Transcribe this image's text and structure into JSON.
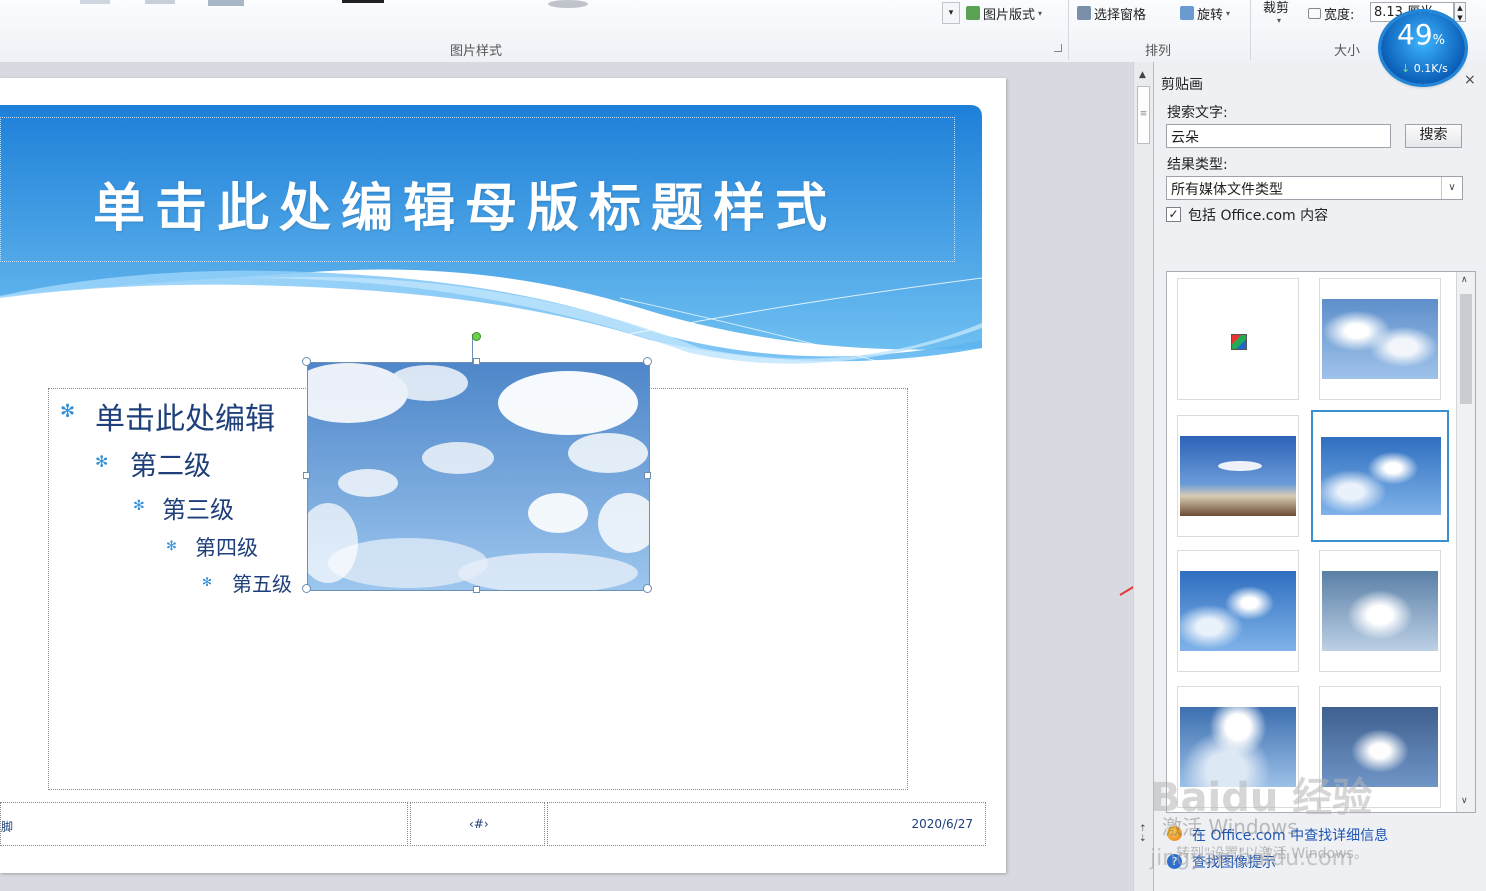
{
  "ribbon": {
    "picture_layout_label": "图片版式",
    "selection_pane_label": "选择窗格",
    "rotate_label": "旋转",
    "crop_label": "裁剪",
    "width_label": "宽度:",
    "width_value": "8.13 厘米",
    "group_picture_styles": "图片样式",
    "group_arrange": "排列",
    "group_size": "大小"
  },
  "speed_widget": {
    "percent": "49",
    "percent_unit": "%",
    "rate": "0.1K/s"
  },
  "slide": {
    "title": "单击此处编辑母版标题样式",
    "levels": [
      "单击此处编辑",
      "第二级",
      "第三级",
      "第四级",
      "第五级"
    ],
    "footer_left": "脚",
    "footer_center": "‹#›",
    "footer_date": "2020/6/27"
  },
  "clipart_pane": {
    "title": "剪贴画",
    "search_label": "搜索文字:",
    "search_value": "云朵",
    "search_button": "搜索",
    "result_type_label": "结果类型:",
    "result_type_value": "所有媒体文件类型",
    "include_office_label": "包括 Office.com 内容",
    "include_office_checked": true,
    "link_office": "在 Office.com 中查找详细信息",
    "link_tips": "查找图像提示"
  },
  "watermark": {
    "activate_line1": "激活 Windows",
    "activate_line2": "转到\"设置\"以激活 Windows。",
    "baidu": "Baidu 经验",
    "url": "jingyan.baidu.com"
  },
  "colors": {
    "accent": "#2f8fd8",
    "title_band_top": "#1d7fd8",
    "title_band_bottom": "#7cc4f2",
    "body_text": "#1e3f7a",
    "arrow": "#e53935"
  }
}
